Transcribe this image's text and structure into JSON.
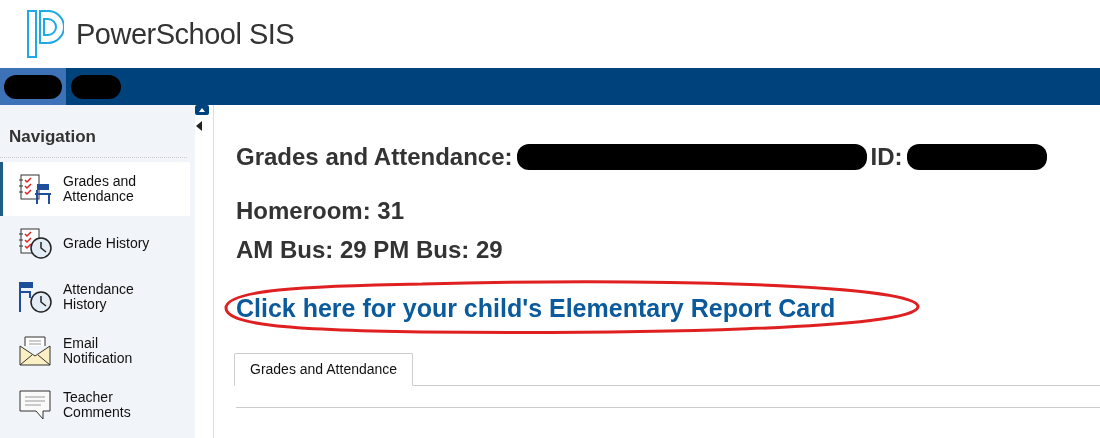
{
  "header": {
    "brand": "PowerSchool SIS"
  },
  "top_tabs": [
    {
      "selected": true
    },
    {
      "selected": false
    }
  ],
  "sidebar": {
    "title": "Navigation",
    "items": [
      {
        "label": "Grades and Attendance",
        "selected": true
      },
      {
        "label": "Grade History",
        "selected": false
      },
      {
        "label": "Attendance History",
        "selected": false
      },
      {
        "label": "Email Notification",
        "selected": false
      },
      {
        "label": "Teacher Comments",
        "selected": false
      }
    ]
  },
  "main": {
    "title": "Grades and Attendance:",
    "id_label": "ID:",
    "homeroom": "Homeroom: 31",
    "bus": "AM Bus: 29 PM Bus: 29",
    "report_card_link": "Click here for your child's Elementary Report Card",
    "tabs": [
      {
        "label": "Grades and Attendance",
        "selected": true
      }
    ]
  }
}
